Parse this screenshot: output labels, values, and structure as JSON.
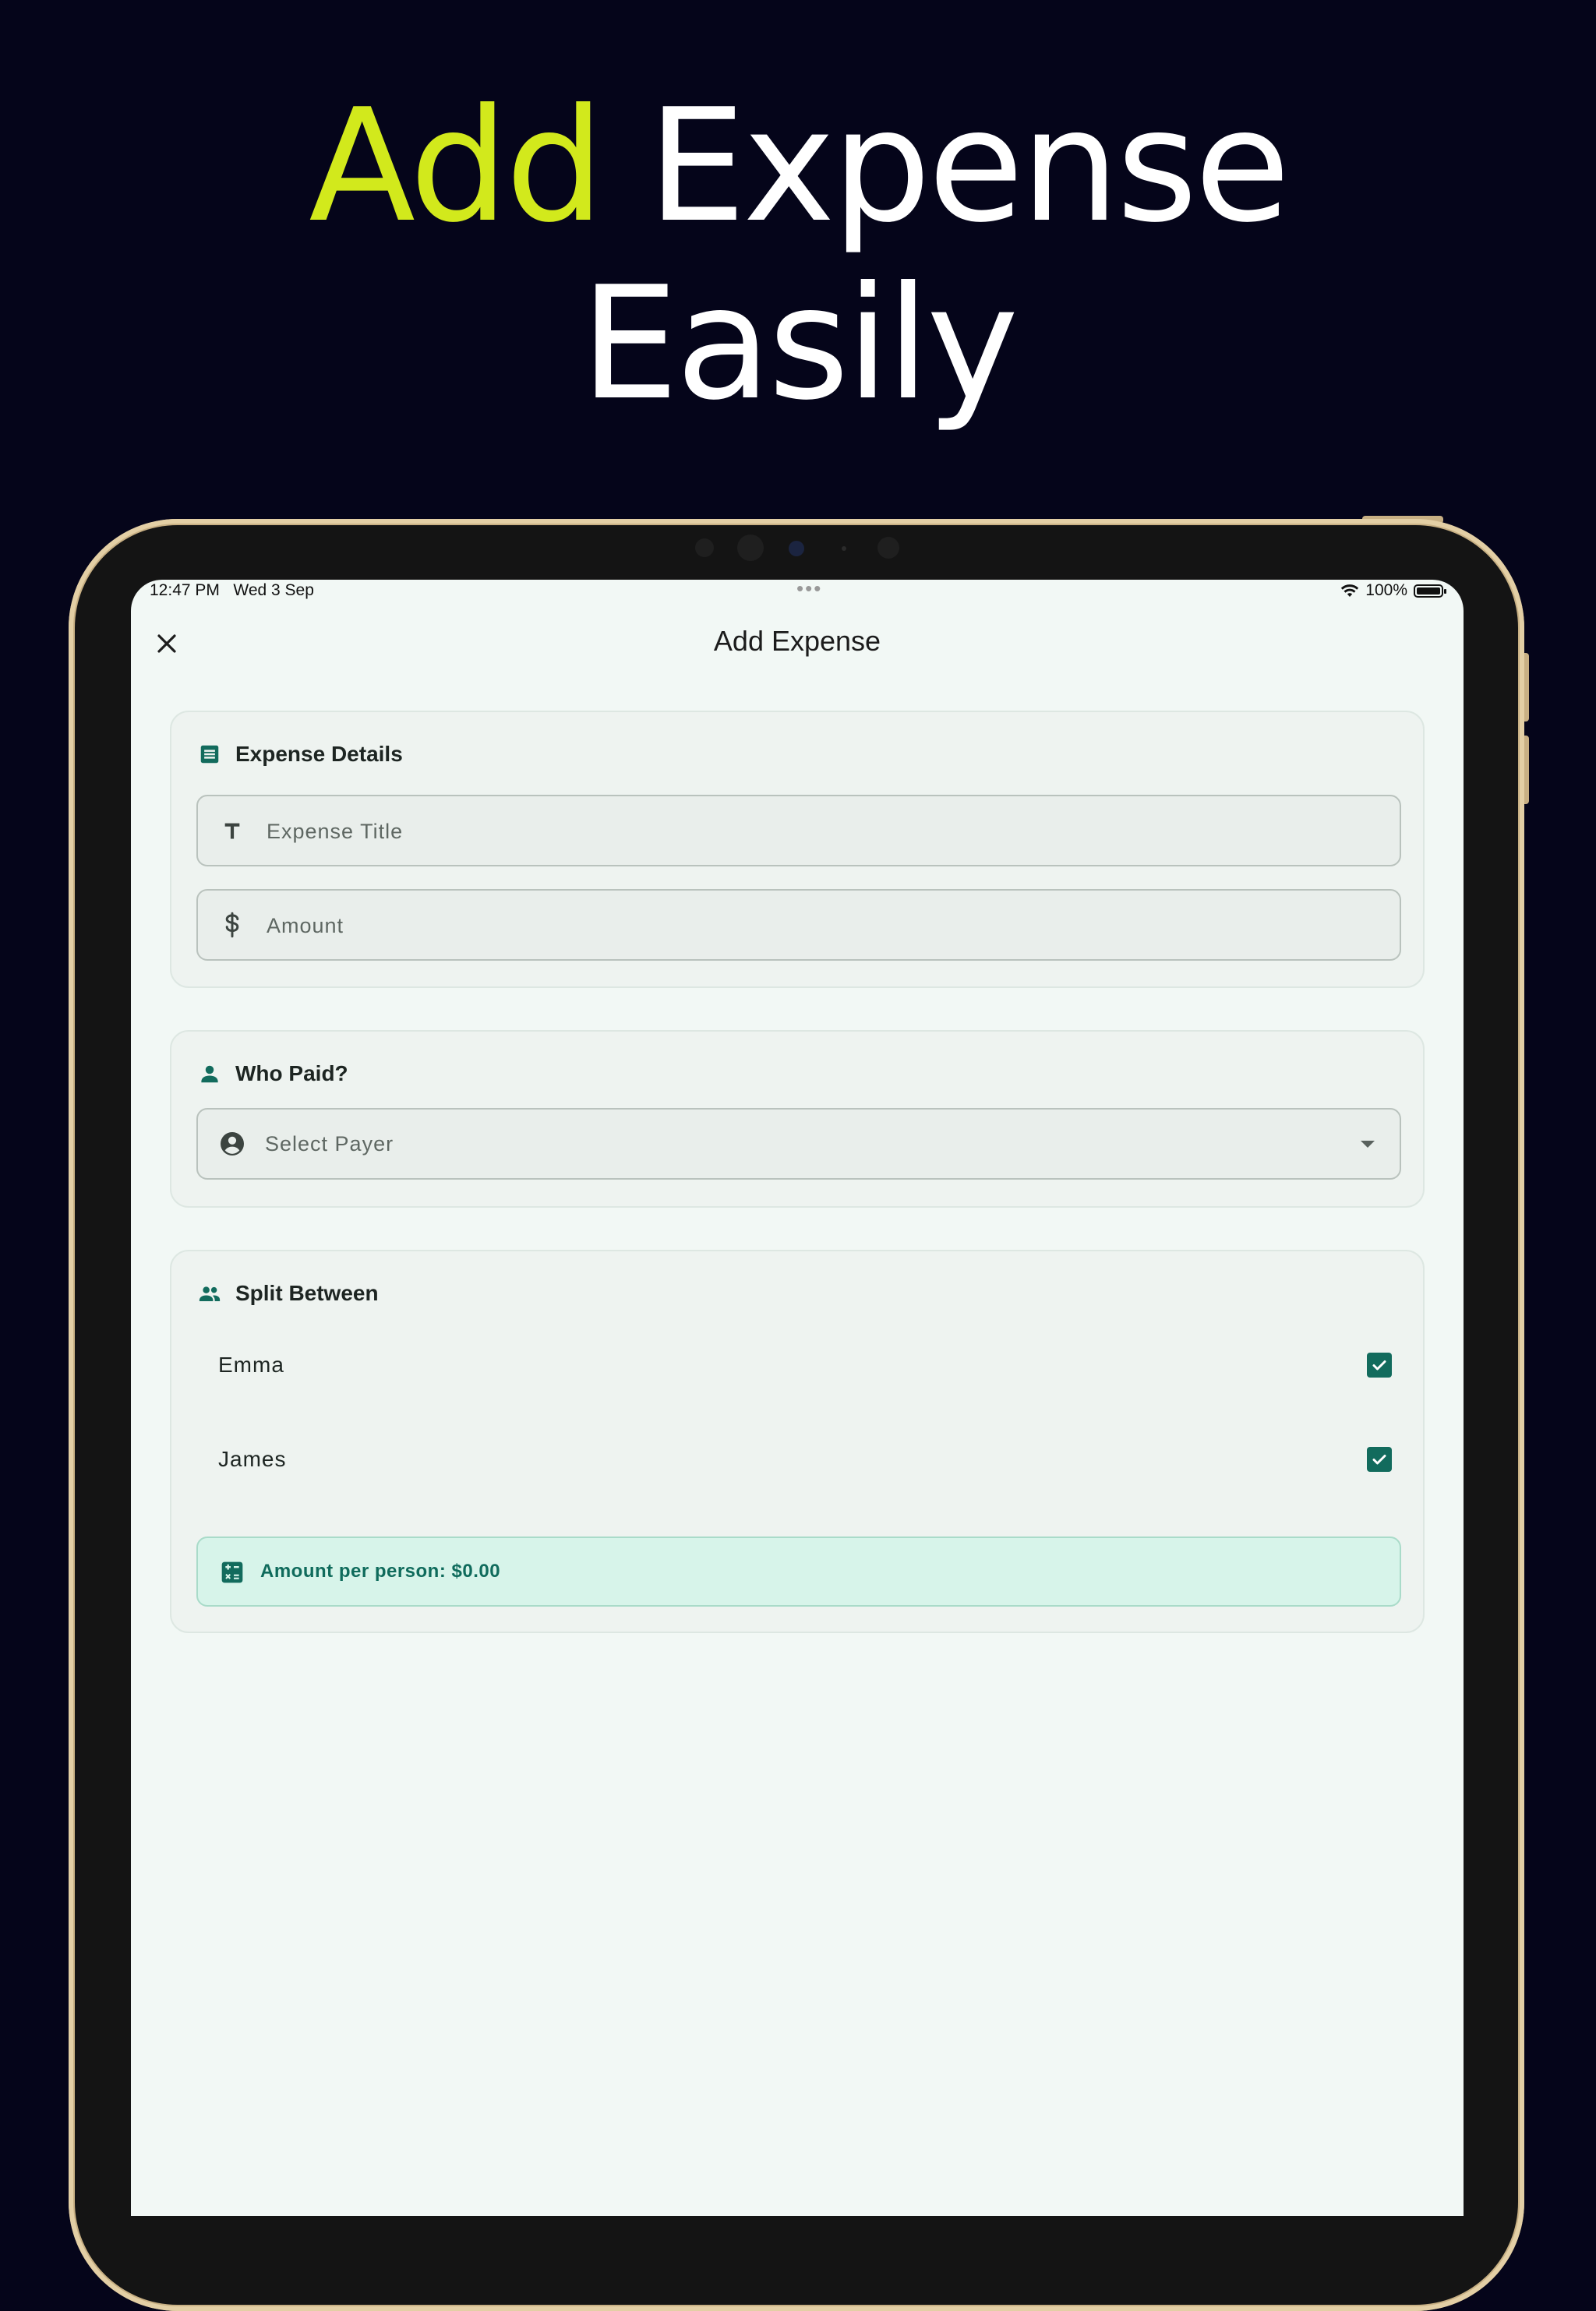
{
  "headline": {
    "accent_word": "Add",
    "rest_line1": "Expense",
    "line2": "Easily"
  },
  "colors": {
    "accent": "#d2e91c",
    "background": "#05051a",
    "primary": "#126b5d",
    "summary_bg": "#d7f4ea"
  },
  "status_bar": {
    "time": "12:47 PM",
    "date": "Wed 3 Sep",
    "battery": "100%"
  },
  "app": {
    "title": "Add Expense",
    "close_icon": "close-icon",
    "expense_details": {
      "heading": "Expense Details",
      "title_placeholder": "Expense Title",
      "amount_placeholder": "Amount"
    },
    "who_paid": {
      "heading": "Who Paid?",
      "payer_placeholder": "Select Payer"
    },
    "split_between": {
      "heading": "Split Between",
      "members": [
        {
          "name": "Emma",
          "checked": true
        },
        {
          "name": "James",
          "checked": true
        }
      ],
      "summary": "Amount per person: $0.00"
    }
  }
}
